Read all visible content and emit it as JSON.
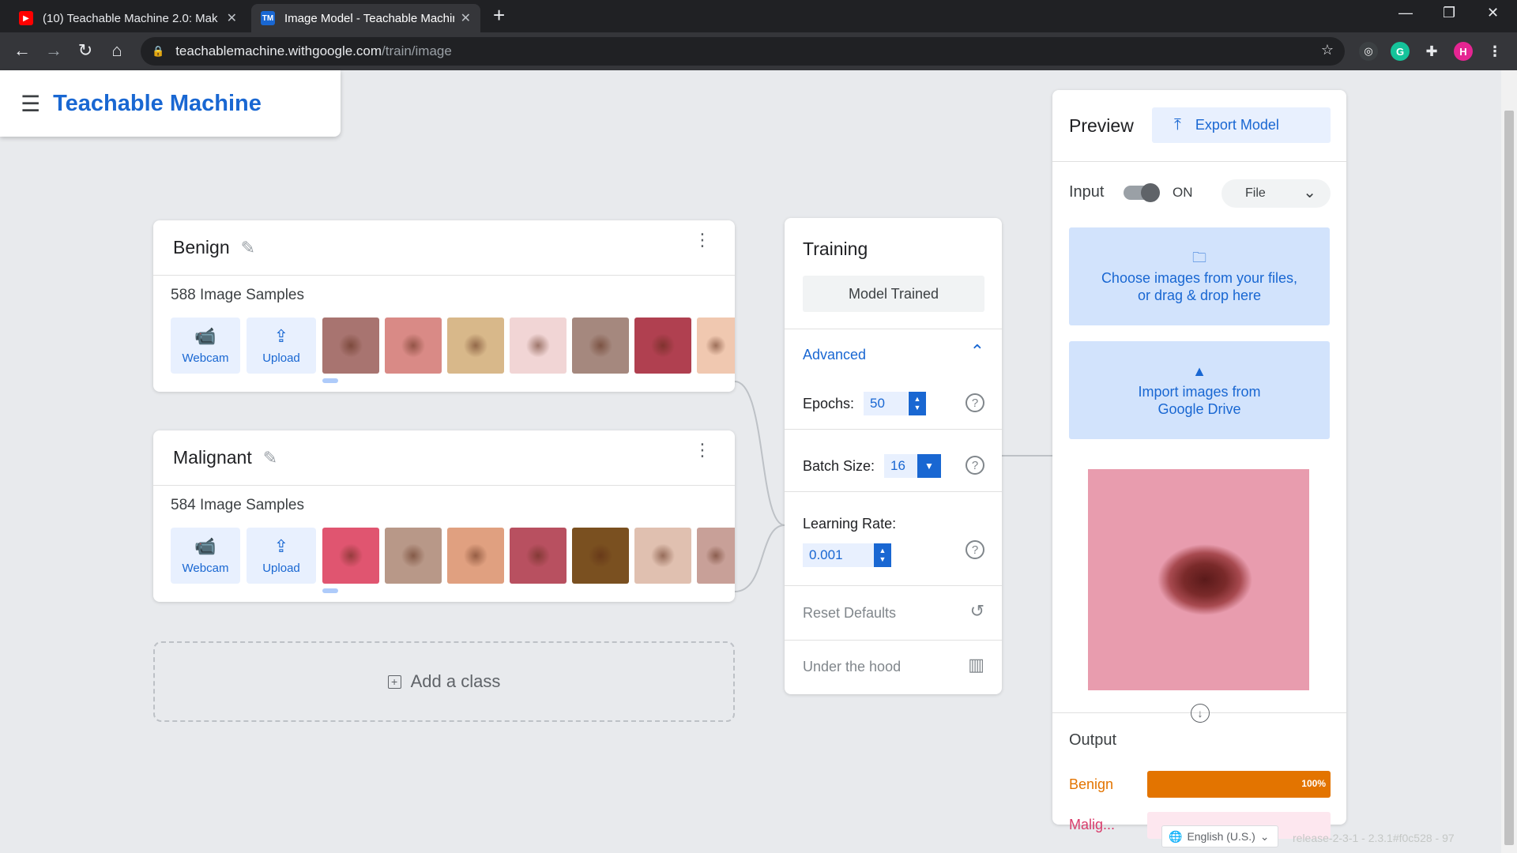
{
  "browser": {
    "tabs": [
      {
        "title": "(10) Teachable Machine 2.0: Mak",
        "active": false,
        "favicon": "youtube-icon"
      },
      {
        "title": "Image Model - Teachable Machin",
        "active": true,
        "favicon": "tm-icon"
      }
    ],
    "url_host": "teachablemachine.withgoogle.com",
    "url_path": "/train/image",
    "profile_initial": "H"
  },
  "app": {
    "logo": "Teachable Machine"
  },
  "classes": [
    {
      "name": "Benign",
      "samples_label": "588 Image Samples",
      "webcam_label": "Webcam",
      "upload_label": "Upload",
      "thumbnail_colors": [
        "#a87470",
        "#d98a86",
        "#d8b88a",
        "#f1d5d5",
        "#a5887e",
        "#b04050",
        "#f0c8b0"
      ]
    },
    {
      "name": "Malignant",
      "samples_label": "584 Image Samples",
      "webcam_label": "Webcam",
      "upload_label": "Upload",
      "thumbnail_colors": [
        "#e05570",
        "#b89888",
        "#e0a080",
        "#b85060",
        "#7a5020",
        "#e0c0b0",
        "#c8a098"
      ]
    }
  ],
  "add_class_label": "Add a class",
  "training": {
    "title": "Training",
    "status_button": "Model Trained",
    "advanced_label": "Advanced",
    "epochs_label": "Epochs:",
    "epochs_value": "50",
    "batch_label": "Batch Size:",
    "batch_value": "16",
    "lr_label": "Learning Rate:",
    "lr_value": "0.001",
    "reset_label": "Reset Defaults",
    "hood_label": "Under the hood"
  },
  "preview": {
    "title": "Preview",
    "export_label": "Export Model",
    "input_label": "Input",
    "toggle_state": "ON",
    "source_select": "File",
    "upload_text_1": "Choose images from your files,",
    "upload_text_2": "or drag & drop here",
    "drive_text_1": "Import images from",
    "drive_text_2": "Google Drive",
    "output_label": "Output",
    "outputs": [
      {
        "name": "Benign",
        "percent_label": "100%",
        "fraction": 1.0,
        "color": "#e37400",
        "track": "#fce8d6"
      },
      {
        "name": "Malig...",
        "percent_label": "",
        "fraction": 0.0,
        "color": "#d93c6b",
        "track": "#fde7ef"
      }
    ]
  },
  "footer": {
    "language": "English (U.S.)",
    "release": "release-2-3-1 - 2.3.1#f0c528 - 97"
  }
}
